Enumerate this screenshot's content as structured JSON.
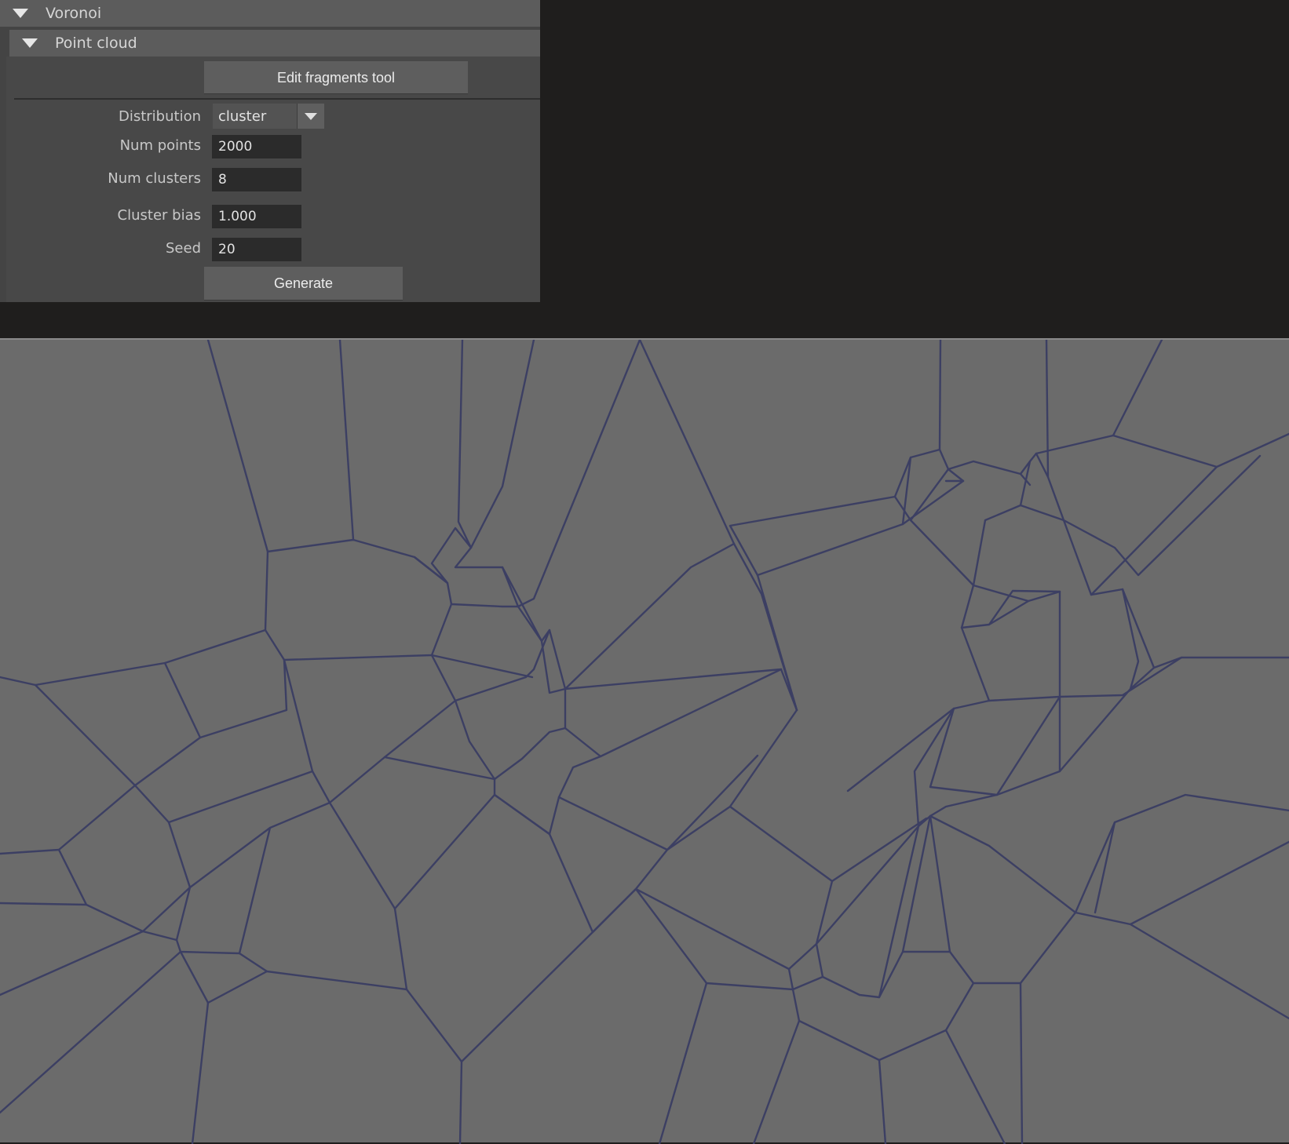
{
  "sections": {
    "voronoi": {
      "title": "Voronoi"
    },
    "point_cloud": {
      "title": "Point cloud"
    }
  },
  "buttons": {
    "edit_fragments": "Edit fragments tool",
    "generate": "Generate"
  },
  "fields": {
    "distribution": {
      "label": "Distribution",
      "value": "cluster"
    },
    "num_points": {
      "label": "Num points",
      "value": "2000"
    },
    "num_clusters": {
      "label": "Num clusters",
      "value": "8"
    },
    "cluster_bias": {
      "label": "Cluster bias",
      "value": "1.000"
    },
    "seed": {
      "label": "Seed",
      "value": "20"
    }
  },
  "colors": {
    "viewport_background": "#6b6b6b",
    "voronoi_edges": "#3c3f63",
    "panel_background": "#444444"
  }
}
